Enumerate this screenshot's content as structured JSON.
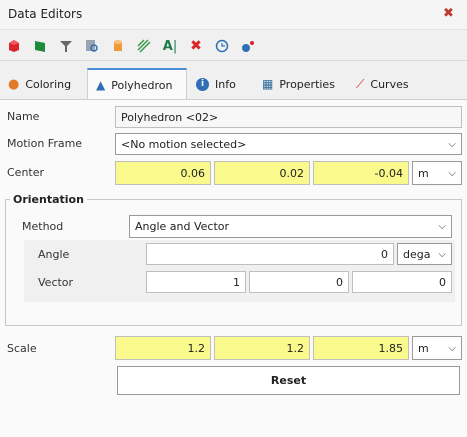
{
  "window": {
    "title": "Data Editors",
    "close_icon": "x"
  },
  "toolbar": {
    "icons": [
      "red-cube-icon",
      "green-flag-icon",
      "funnel-icon",
      "search-doc-icon",
      "cylinder-icon",
      "hatch-icon",
      "text-a-icon",
      "delete-x-icon",
      "clock-icon",
      "sparkle-icon"
    ]
  },
  "tabs": [
    {
      "label": "Coloring",
      "icon": "palette-icon"
    },
    {
      "label": "Polyhedron",
      "icon": "cone-icon",
      "active": true
    },
    {
      "label": "Info",
      "icon": "info-icon"
    },
    {
      "label": "Properties",
      "icon": "properties-icon"
    },
    {
      "label": "Curves",
      "icon": "curves-icon"
    }
  ],
  "form": {
    "name_label": "Name",
    "name_value": "Polyhedron <02>",
    "motion_label": "Motion Frame",
    "motion_value": "<No motion selected>",
    "center_label": "Center",
    "center": [
      "0.06",
      "0.02",
      "-0.04"
    ],
    "center_unit": "m",
    "orientation_title": "Orientation",
    "method_label": "Method",
    "method_value": "Angle and Vector",
    "angle_label": "Angle",
    "angle_value": "0",
    "angle_unit": "dega",
    "vector_label": "Vector",
    "vector": [
      "1",
      "0",
      "0"
    ],
    "scale_label": "Scale",
    "scale": [
      "1.2",
      "1.2",
      "1.85"
    ],
    "scale_unit": "m",
    "reset_label": "Reset"
  },
  "colors": {
    "highlight": "#fafa8c",
    "tab_accent": "#4a90d9"
  }
}
